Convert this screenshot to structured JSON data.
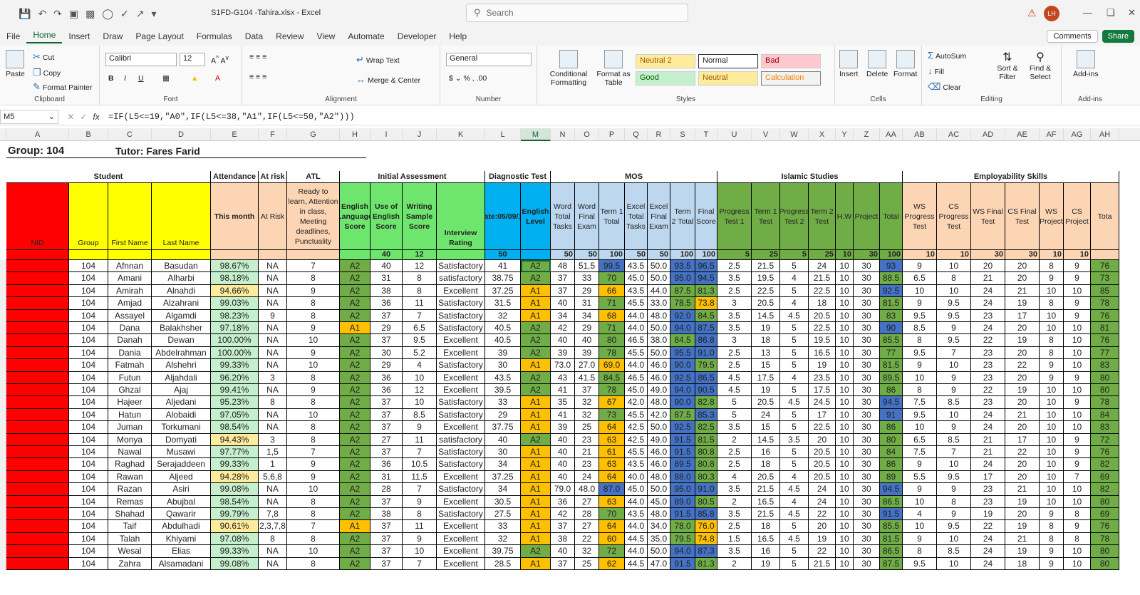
{
  "window": {
    "title": "S1FD-G104 -Tahira.xlsx  -  Excel",
    "search_placeholder": "Search",
    "user_initials": "LH"
  },
  "menu": {
    "tabs": [
      "File",
      "Home",
      "Insert",
      "Draw",
      "Page Layout",
      "Formulas",
      "Data",
      "Review",
      "View",
      "Automate",
      "Developer",
      "Help"
    ],
    "comments": "Comments",
    "share": "Share"
  },
  "ribbon": {
    "clipboard": {
      "paste": "Paste",
      "cut": "Cut",
      "copy": "Copy",
      "format_painter": "Format Painter",
      "label": "Clipboard"
    },
    "font": {
      "name": "Calibri",
      "size": "12",
      "label": "Font"
    },
    "alignment": {
      "wrap": "Wrap Text",
      "merge": "Merge & Center",
      "label": "Alignment"
    },
    "number": {
      "format": "General",
      "label": "Number"
    },
    "styles": {
      "conditional": "Conditional Formatting",
      "format_table": "Format as Table",
      "neutral2": "Neutral 2",
      "normal": "Normal",
      "bad": "Bad",
      "good": "Good",
      "neutral": "Neutral",
      "calculation": "Calculation",
      "label": "Styles"
    },
    "cells": {
      "insert": "Insert",
      "delete": "Delete",
      "format": "Format",
      "label": "Cells"
    },
    "editing": {
      "autosum": "AutoSum",
      "fill": "Fill",
      "clear": "Clear",
      "sort": "Sort & Filter",
      "find": "Find & Select",
      "label": "Editing"
    },
    "addins": {
      "addins": "Add-ins",
      "label": "Add-ins"
    }
  },
  "formula_bar": {
    "cell": "M5",
    "formula": "=IF(L5<=19,\"A0\",IF(L5<=38,\"A1\",IF(L5<=50,\"A2\")))"
  },
  "columns": [
    "A",
    "B",
    "C",
    "D",
    "E",
    "F",
    "G",
    "H",
    "I",
    "J",
    "K",
    "L",
    "M",
    "N",
    "O",
    "P",
    "Q",
    "R",
    "S",
    "T",
    "U",
    "V",
    "W",
    "X",
    "Y",
    "Z",
    "AA",
    "AB",
    "AC",
    "AD",
    "AE",
    "AF",
    "AG",
    "AH"
  ],
  "sheet": {
    "group_title": "Group:  104",
    "tutor_title": "Tutor:  Fares Farid",
    "sections": {
      "student": "Student",
      "attendance": "Attendance",
      "at_risk": "At risk",
      "atl": "ATL",
      "initial": "Initial Assessment",
      "diagnostic": "Diagnostic Test",
      "mos": "MOS",
      "islamic": "Islamic Studies",
      "employ": "Employability Skills"
    },
    "headers": {
      "nid": "NID",
      "group": "Group",
      "first": "First Name",
      "last": "Last Name",
      "this_month": "This month",
      "at_risk": "At Risk",
      "atl": "Ready to learn, Attention in class, Meeting deadlines, Punctuality",
      "eng_score": "English Language Score",
      "use_eng": "Use of English Score",
      "writing": "Writing Sample Score",
      "interview": "Interview Rating",
      "date": "Date:05/09/19",
      "eng_level": "English Level",
      "word_tasks": "Word Total Tasks",
      "word_final": "Word Final Exam",
      "term1": "Term 1 Total",
      "excel_tasks": "Excel Total Tasks",
      "excel_final": "Excel Final Exam",
      "term2": "Term 2 Total",
      "final": "Final Score",
      "pt1": "Progress Test 1",
      "is_t1": "Term 1 Test",
      "pt2": "Progress Test 2",
      "is_t2": "Term 2 Test",
      "hw": "H.W",
      "project": "Project",
      "total": "Total",
      "ws_pt": "WS Progress Test",
      "cs_pt": "CS Progress Test",
      "ws_final": "WS Final Test",
      "cs_final": "CS Final Test",
      "ws_proj": "WS Project",
      "cs_proj": "CS Project",
      "tot": "Tota"
    },
    "maxes": {
      "use_eng": "40",
      "writing": "12",
      "date": "50",
      "word_tasks": "50",
      "word_final": "50",
      "term1": "100",
      "excel_tasks": "50",
      "excel_final": "50",
      "term2": "100",
      "final": "100",
      "pt1": "5",
      "is_t1": "25",
      "pt2": "5",
      "is_t2": "25",
      "hw": "10",
      "project": "30",
      "total": "100",
      "ws_pt": "10",
      "cs_pt": "10",
      "ws_final": "30",
      "cs_final": "30",
      "ws_proj": "10",
      "cs_proj": "10"
    },
    "rows": [
      [
        "104",
        "Afnnan",
        "Basudan",
        "98.67%",
        "NA",
        "7",
        "A2",
        "40",
        "12",
        "Satisfactory",
        "41",
        "A2",
        "48",
        "51.5",
        "99.5",
        "43.5",
        "50.0",
        "93.5",
        "96.5",
        "2.5",
        "21.5",
        "5",
        "24",
        "10",
        "30",
        "93",
        "9",
        "10",
        "20",
        "20",
        "8",
        "9",
        "76"
      ],
      [
        "104",
        "Amani",
        "Alharbi",
        "98.18%",
        "NA",
        "8",
        "A2",
        "31",
        "8",
        "satisfactory",
        "38.75",
        "A2",
        "37",
        "33",
        "70",
        "45.0",
        "50.0",
        "95.0",
        "94.5",
        "3.5",
        "19.5",
        "4",
        "21.5",
        "10",
        "30",
        "88.5",
        "6.5",
        "8",
        "21",
        "20",
        "9",
        "9",
        "73"
      ],
      [
        "104",
        "Amirah",
        "Alnahdi",
        "94.66%",
        "NA",
        "9",
        "A2",
        "38",
        "8",
        "Excellent",
        "37.25",
        "A1",
        "37",
        "29",
        "66",
        "43.5",
        "44.0",
        "87.5",
        "81.3",
        "2.5",
        "22.5",
        "5",
        "22.5",
        "10",
        "30",
        "92.5",
        "10",
        "10",
        "24",
        "21",
        "10",
        "10",
        "85"
      ],
      [
        "104",
        "Amjad",
        "Alzahrani",
        "99.03%",
        "NA",
        "8",
        "A2",
        "36",
        "11",
        "Satisfactory",
        "31.5",
        "A1",
        "40",
        "31",
        "71",
        "45.5",
        "33.0",
        "78.5",
        "73.8",
        "3",
        "20.5",
        "4",
        "18",
        "10",
        "30",
        "81.5",
        "9",
        "9.5",
        "24",
        "19",
        "8",
        "9",
        "78"
      ],
      [
        "104",
        "Assayel",
        "Algamdi",
        "98.23%",
        "9",
        "8",
        "A2",
        "37",
        "7",
        "Satisfactory",
        "32",
        "A1",
        "34",
        "34",
        "68",
        "44.0",
        "48.0",
        "92.0",
        "84.5",
        "3.5",
        "14.5",
        "4.5",
        "20.5",
        "10",
        "30",
        "83",
        "9.5",
        "9.5",
        "23",
        "17",
        "10",
        "9",
        "76"
      ],
      [
        "104",
        "Dana",
        "Balakhsher",
        "97.18%",
        "NA",
        "9",
        "A1",
        "29",
        "6.5",
        "Satisfactory",
        "40.5",
        "A2",
        "42",
        "29",
        "71",
        "44.0",
        "50.0",
        "94.0",
        "87.5",
        "3.5",
        "19",
        "5",
        "22.5",
        "10",
        "30",
        "90",
        "8.5",
        "9",
        "24",
        "20",
        "10",
        "10",
        "81"
      ],
      [
        "104",
        "Danah",
        "Dewan",
        "100.00%",
        "NA",
        "10",
        "A2",
        "37",
        "9.5",
        "Excellent",
        "40.5",
        "A2",
        "40",
        "40",
        "80",
        "46.5",
        "38.0",
        "84.5",
        "86.8",
        "3",
        "18",
        "5",
        "19.5",
        "10",
        "30",
        "85.5",
        "8",
        "9.5",
        "22",
        "19",
        "8",
        "10",
        "76"
      ],
      [
        "104",
        "Dania",
        "Abdelrahman",
        "100.00%",
        "NA",
        "9",
        "A2",
        "30",
        "5.2",
        "Excellent",
        "39",
        "A2",
        "39",
        "39",
        "78",
        "45.5",
        "50.0",
        "95.5",
        "91.0",
        "2.5",
        "13",
        "5",
        "16.5",
        "10",
        "30",
        "77",
        "9.5",
        "7",
        "23",
        "20",
        "8",
        "10",
        "77"
      ],
      [
        "104",
        "Fatmah",
        "Alshehri",
        "99.33%",
        "NA",
        "10",
        "A2",
        "29",
        "4",
        "Satisfactory",
        "30",
        "A1",
        "73.0",
        "27.0",
        "69.0",
        "44.0",
        "46.0",
        "90.0",
        "79.5",
        "2.5",
        "15",
        "5",
        "19",
        "10",
        "30",
        "81.5",
        "9",
        "10",
        "23",
        "22",
        "9",
        "10",
        "83"
      ],
      [
        "104",
        "Futun",
        "Aljahdali",
        "96.20%",
        "3",
        "8",
        "A2",
        "36",
        "10",
        "Excellent",
        "43.5",
        "A2",
        "43",
        "41.5",
        "84.5",
        "46.5",
        "46.0",
        "92.5",
        "86.5",
        "4.5",
        "17.5",
        "4",
        "23.5",
        "10",
        "30",
        "89.5",
        "10",
        "9",
        "23",
        "20",
        "9",
        "9",
        "80"
      ],
      [
        "104",
        "Ghzal",
        "Ajaj",
        "99.41%",
        "NA",
        "9",
        "A2",
        "36",
        "12",
        "Excellent",
        "39.5",
        "A2",
        "41",
        "37",
        "78",
        "45.0",
        "49.0",
        "94.0",
        "90.5",
        "4.5",
        "19",
        "5",
        "17.5",
        "10",
        "30",
        "86",
        "8",
        "9",
        "22",
        "19",
        "10",
        "10",
        "80"
      ],
      [
        "104",
        "Hajeer",
        "Aljedani",
        "95.23%",
        "8",
        "8",
        "A2",
        "37",
        "10",
        "Satisfactory",
        "33",
        "A1",
        "35",
        "32",
        "67",
        "42.0",
        "48.0",
        "90.0",
        "82.8",
        "5",
        "20.5",
        "4.5",
        "24.5",
        "10",
        "30",
        "94.5",
        "7.5",
        "8.5",
        "23",
        "20",
        "10",
        "9",
        "78"
      ],
      [
        "104",
        "Hatun",
        "Alobaidi",
        "97.05%",
        "NA",
        "10",
        "A2",
        "37",
        "8.5",
        "Satisfactory",
        "29",
        "A1",
        "41",
        "32",
        "73",
        "45.5",
        "42.0",
        "87.5",
        "85.3",
        "5",
        "24",
        "5",
        "17",
        "10",
        "30",
        "91",
        "9.5",
        "10",
        "24",
        "21",
        "10",
        "10",
        "84"
      ],
      [
        "104",
        "Juman",
        "Torkumani",
        "98.54%",
        "NA",
        "8",
        "A2",
        "37",
        "9",
        "Excellent",
        "37.75",
        "A1",
        "39",
        "25",
        "64",
        "42.5",
        "50.0",
        "92.5",
        "82.5",
        "3.5",
        "15",
        "5",
        "22.5",
        "10",
        "30",
        "86",
        "10",
        "9",
        "24",
        "20",
        "10",
        "10",
        "83"
      ],
      [
        "104",
        "Monya",
        "Domyati",
        "94.43%",
        "3",
        "8",
        "A2",
        "27",
        "11",
        "satisfactory",
        "40",
        "A2",
        "40",
        "23",
        "63",
        "42.5",
        "49.0",
        "91.5",
        "81.5",
        "2",
        "14.5",
        "3.5",
        "20",
        "10",
        "30",
        "80",
        "6.5",
        "8.5",
        "21",
        "17",
        "10",
        "9",
        "72"
      ],
      [
        "104",
        "Nawal",
        "Musawi",
        "97.77%",
        "1,5",
        "7",
        "A2",
        "37",
        "7",
        "Satisfactory",
        "30",
        "A1",
        "40",
        "21",
        "61",
        "45.5",
        "46.0",
        "91.5",
        "80.8",
        "2.5",
        "16",
        "5",
        "20.5",
        "10",
        "30",
        "84",
        "7.5",
        "7",
        "21",
        "22",
        "10",
        "9",
        "76"
      ],
      [
        "104",
        "Raghad",
        "Serajaddeen",
        "99.33%",
        "1",
        "9",
        "A2",
        "36",
        "10.5",
        "Satisfactory",
        "34",
        "A1",
        "40",
        "23",
        "63",
        "43.5",
        "46.0",
        "89.5",
        "80.8",
        "2.5",
        "18",
        "5",
        "20.5",
        "10",
        "30",
        "86",
        "9",
        "10",
        "24",
        "20",
        "10",
        "9",
        "82"
      ],
      [
        "104",
        "Rawan",
        "Aljeed",
        "94.28%",
        "5,6,8",
        "9",
        "A2",
        "31",
        "11.5",
        "Excellent",
        "37.25",
        "A1",
        "40",
        "24",
        "64",
        "40.0",
        "48.0",
        "88.0",
        "80.3",
        "4",
        "20.5",
        "4",
        "20.5",
        "10",
        "30",
        "89",
        "5.5",
        "9.5",
        "17",
        "20",
        "10",
        "7",
        "69"
      ],
      [
        "104",
        "Razan",
        "Asiri",
        "99.08%",
        "NA",
        "10",
        "A2",
        "28",
        "7",
        "Satisfactory",
        "34",
        "A1",
        "79.0",
        "48.0",
        "87.0",
        "45.0",
        "50.0",
        "95.0",
        "91.0",
        "3.5",
        "21.5",
        "4.5",
        "24",
        "10",
        "30",
        "94.5",
        "9",
        "9",
        "23",
        "21",
        "10",
        "10",
        "82"
      ],
      [
        "104",
        "Remas",
        "Abujbal",
        "98.54%",
        "NA",
        "8",
        "A2",
        "37",
        "9",
        "Excellent",
        "30.5",
        "A1",
        "36",
        "27",
        "63",
        "44.0",
        "45.0",
        "89.0",
        "80.5",
        "2",
        "16.5",
        "4",
        "24",
        "10",
        "30",
        "86.5",
        "10",
        "8",
        "23",
        "19",
        "10",
        "10",
        "80"
      ],
      [
        "104",
        "Shahad",
        "Qawarir",
        "99.79%",
        "7,8",
        "8",
        "A2",
        "38",
        "8",
        "Satisfactory",
        "27.5",
        "A1",
        "42",
        "28",
        "70",
        "43.5",
        "48.0",
        "91.5",
        "85.8",
        "3.5",
        "21.5",
        "4.5",
        "22",
        "10",
        "30",
        "91.5",
        "4",
        "9",
        "19",
        "20",
        "9",
        "8",
        "69"
      ],
      [
        "104",
        "Taif",
        "Abdulhadi",
        "90.61%",
        "2,3,7,8",
        "7",
        "A1",
        "37",
        "11",
        "Excellent",
        "33",
        "A1",
        "37",
        "27",
        "64",
        "44.0",
        "34.0",
        "78.0",
        "76.0",
        "2.5",
        "18",
        "5",
        "20",
        "10",
        "30",
        "85.5",
        "10",
        "9.5",
        "22",
        "19",
        "8",
        "9",
        "76"
      ],
      [
        "104",
        "Talah",
        "Khiyami",
        "97.08%",
        "8",
        "8",
        "A2",
        "37",
        "9",
        "Excellent",
        "32",
        "A1",
        "38",
        "22",
        "60",
        "44.5",
        "35.0",
        "79.5",
        "74.8",
        "1.5",
        "16.5",
        "4.5",
        "19",
        "10",
        "30",
        "81.5",
        "9",
        "10",
        "24",
        "21",
        "8",
        "8",
        "78"
      ],
      [
        "104",
        "Wesal",
        "Elias",
        "99.33%",
        "NA",
        "10",
        "A2",
        "37",
        "10",
        "Excellent",
        "39.75",
        "A2",
        "40",
        "32",
        "72",
        "44.0",
        "50.0",
        "94.0",
        "87.3",
        "3.5",
        "16",
        "5",
        "22",
        "10",
        "30",
        "86.5",
        "8",
        "8.5",
        "24",
        "19",
        "9",
        "10",
        "80"
      ],
      [
        "104",
        "Zahra",
        "Alsamadani",
        "99.08%",
        "NA",
        "8",
        "A2",
        "37",
        "7",
        "Excellent",
        "28.5",
        "A1",
        "37",
        "25",
        "62",
        "44.5",
        "47.0",
        "91.5",
        "81.3",
        "2",
        "19",
        "5",
        "21.5",
        "10",
        "30",
        "87.5",
        "9.5",
        "10",
        "24",
        "18",
        "9",
        "10",
        "80"
      ]
    ]
  }
}
